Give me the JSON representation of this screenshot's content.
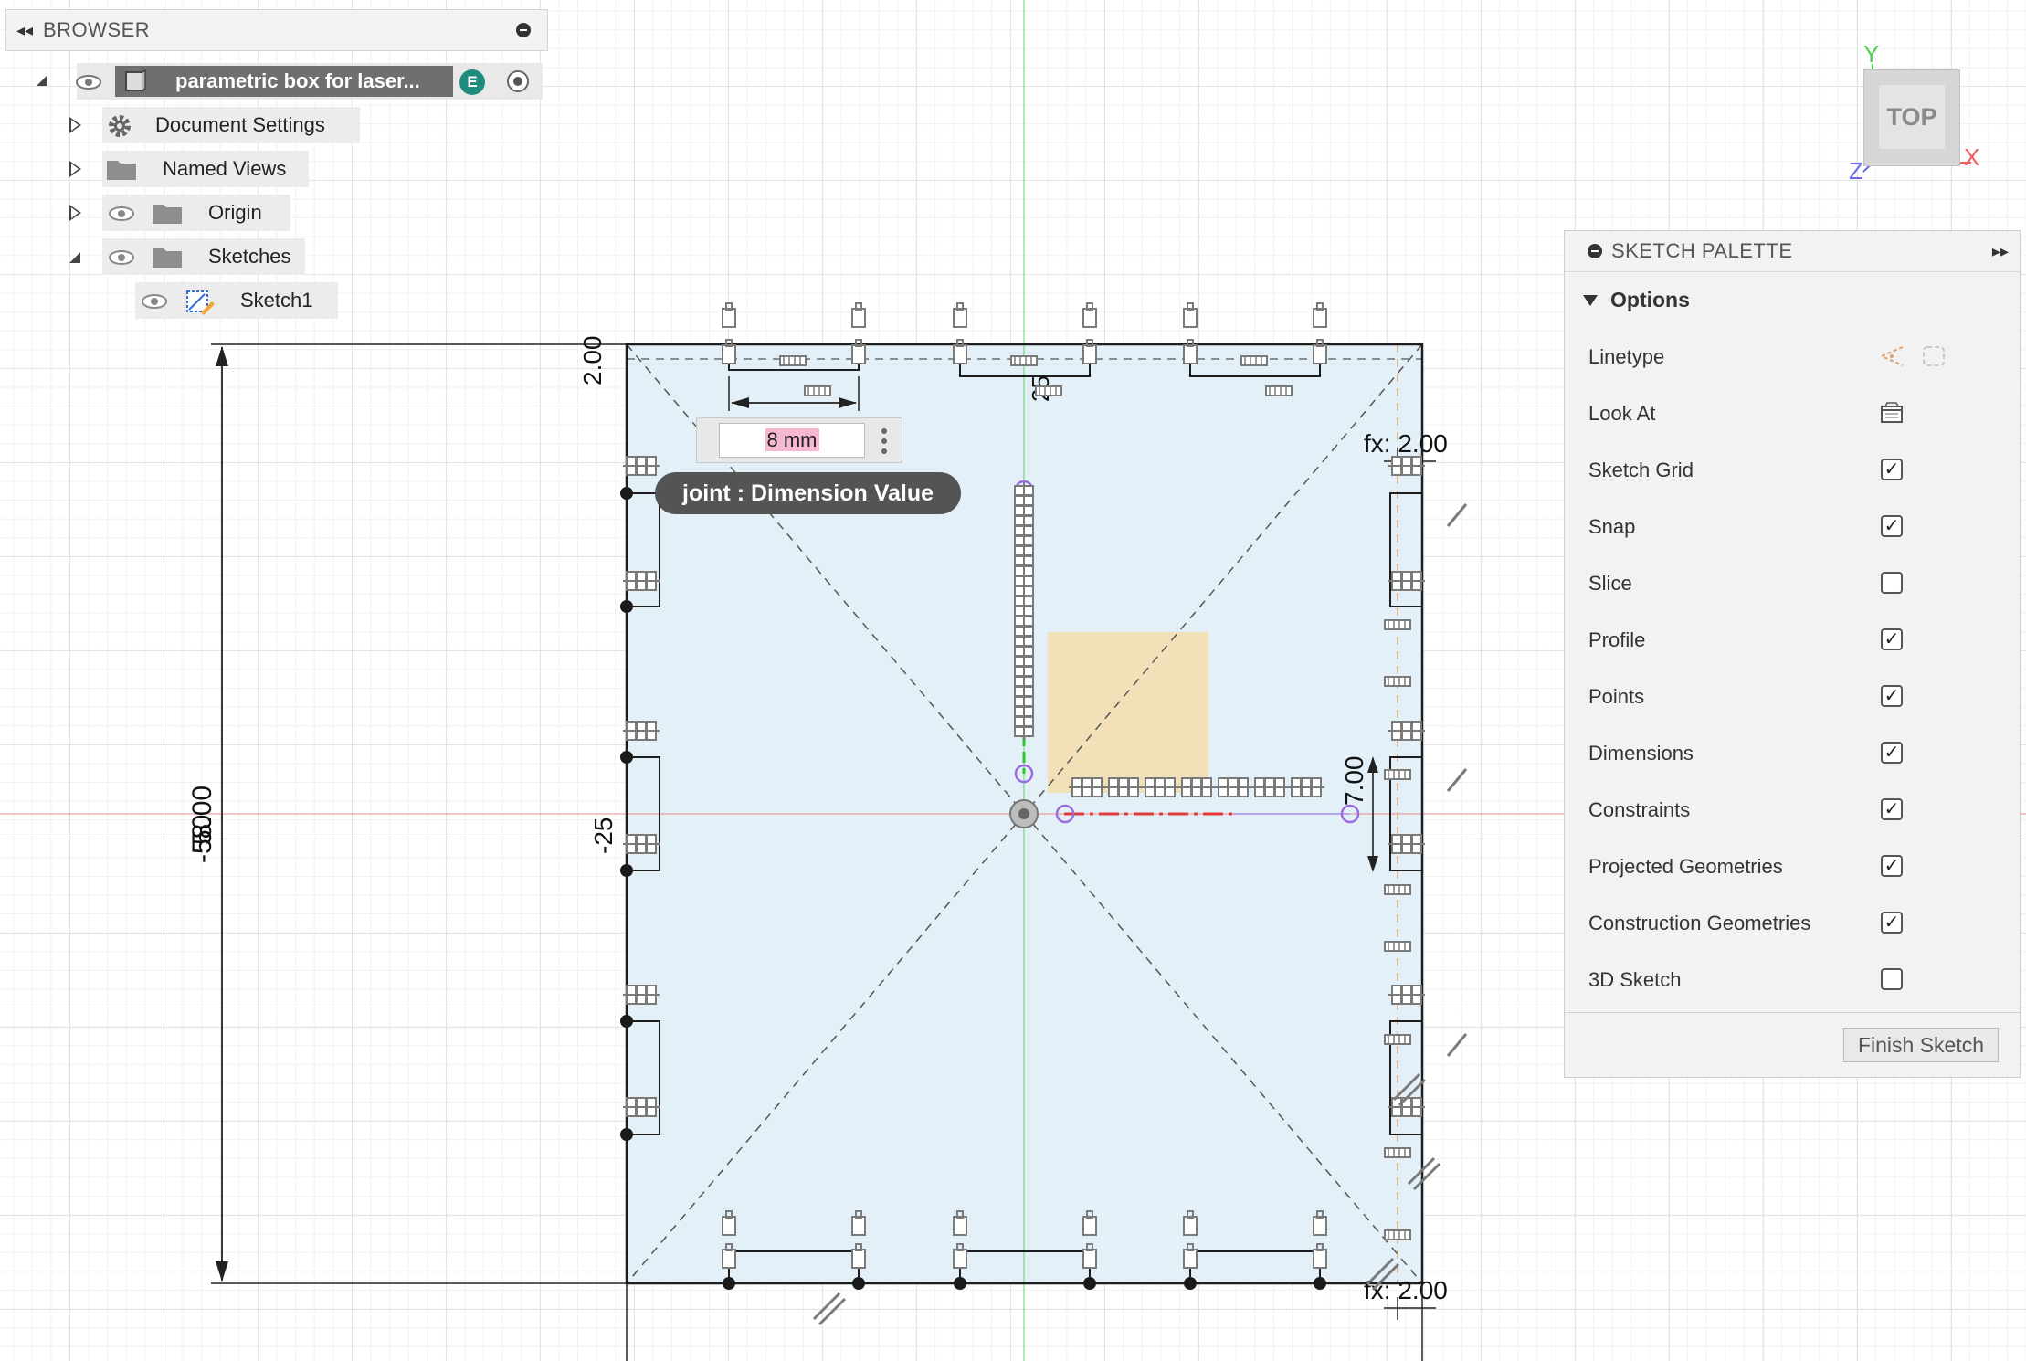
{
  "browser": {
    "title": "BROWSER",
    "root_label": "parametric box for laser...",
    "root_badge": "E",
    "items": [
      {
        "label": "Document Settings"
      },
      {
        "label": "Named Views"
      },
      {
        "label": "Origin"
      },
      {
        "label": "Sketches"
      },
      {
        "label": "Sketch1"
      }
    ]
  },
  "palette": {
    "title": "SKETCH PALETTE",
    "section": "Options",
    "options": [
      {
        "label": "Linetype",
        "control": "icons"
      },
      {
        "label": "Look At",
        "control": "icon"
      },
      {
        "label": "Sketch Grid",
        "checked": true
      },
      {
        "label": "Snap",
        "checked": true
      },
      {
        "label": "Slice",
        "checked": false
      },
      {
        "label": "Profile",
        "checked": true
      },
      {
        "label": "Points",
        "checked": true
      },
      {
        "label": "Dimensions",
        "checked": true
      },
      {
        "label": "Constraints",
        "checked": true
      },
      {
        "label": "Projected Geometries",
        "checked": true
      },
      {
        "label": "Construction Geometries",
        "checked": true
      },
      {
        "label": "3D Sketch",
        "checked": false
      }
    ],
    "finish_label": "Finish Sketch"
  },
  "dimension_editor": {
    "value": "8 mm",
    "tooltip": "joint : Dimension Value"
  },
  "sketch_labels": {
    "top_thickness": "2.00",
    "center_up": "25",
    "right_fx_top": "fx: 2.00",
    "right_fx_bottom": "fx: 2.00",
    "left_overall": "-58.00",
    "left_overlap": "50",
    "left_offset": "-25",
    "right_seven": "7.00"
  },
  "viewcube": {
    "face": "TOP",
    "axis_y": "Y",
    "axis_x": "X",
    "axis_z": "Z"
  },
  "colors": {
    "x_axis": "#e35a5a",
    "y_axis": "#2fc52f",
    "z_axis": "#6b6be8",
    "profile_fill": "#e4f0f8",
    "selection_fill": "#f2dfb4",
    "constraint_purple": "#9c6be0",
    "root_bar": "#6f6f6f",
    "badge": "#1d8c7e"
  }
}
